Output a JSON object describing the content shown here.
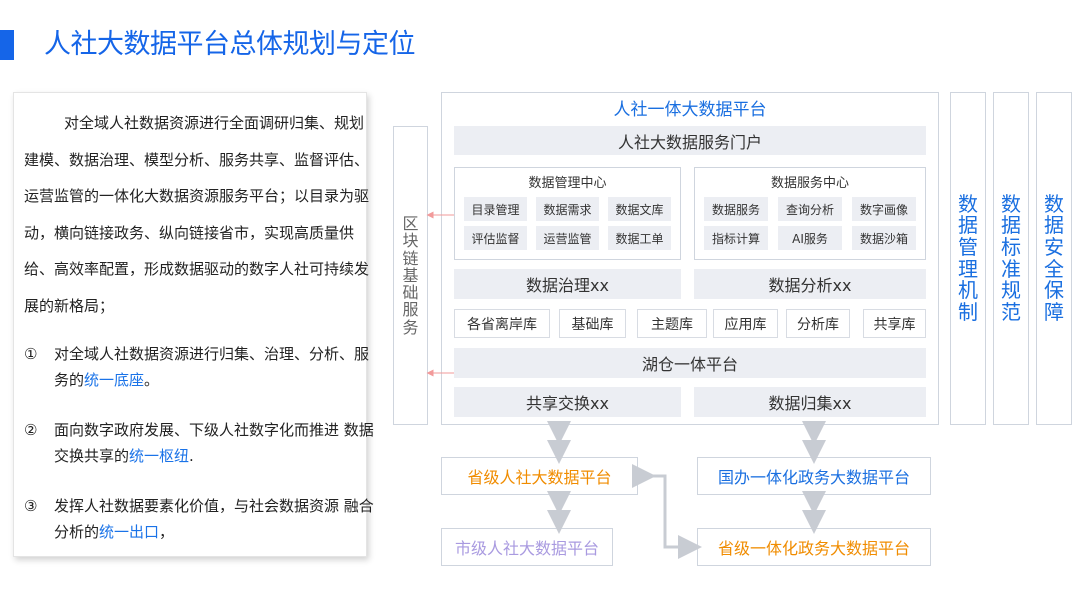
{
  "page": {
    "title": "人社大数据平台总体规划与定位"
  },
  "text_panel": {
    "intro": "对全域人社数据资源进行全面调研归集、规划建模、数据治理、模型分析、服务共享、监督评估、运营监管的一体化大数据资源服务平台；以目录为驱动，横向链接政务、纵向链接省市，实现高质量供给、高效率配置，形成数据驱动的数字人社可持续发展的新格局；",
    "points": [
      {
        "num": "①",
        "text": "对全域人社数据资源进行归集、治理、分析、服务的",
        "highlight": "统一底座",
        "tail": "。"
      },
      {
        "num": "②",
        "text": "面向数字政府发展、下级人社数字化而推进 数据交换共享的",
        "highlight": "统一枢纽",
        "tail": "."
      },
      {
        "num": "③",
        "text": "发挥人社数据要素化价值，与社会数据资源 融合分析的",
        "highlight": "统一出口",
        "tail": "，"
      }
    ]
  },
  "diagram": {
    "blockchain": "区块链基础服务",
    "platform_title": "人社一体大数据平台",
    "portal": "人社大数据服务门户",
    "mgmt_center": {
      "title": "数据管理中心",
      "items": [
        "目录管理",
        "数据需求",
        "数据文库",
        "评估监督",
        "运营监管",
        "数据工单"
      ]
    },
    "service_center": {
      "title": "数据服务中心",
      "items": [
        "数据服务",
        "查询分析",
        "数字画像",
        "指标计算",
        "AI服务",
        "数据沙箱"
      ]
    },
    "governance": "数据治理xx",
    "analysis": "数据分析xx",
    "libraries": [
      "各省离岸库",
      "基础库",
      "主题库",
      "应用库",
      "分析库",
      "共享库"
    ],
    "lakehouse": "湖仓一体平台",
    "exchange": "共享交换xx",
    "collection": "数据归集xx",
    "side_columns": [
      "数据管理机制",
      "数据标准规范",
      "数据安全保障"
    ],
    "provincial": "省级人社大数据平台",
    "national": "国办一体化政务大数据平台",
    "city": "市级人社大数据平台",
    "provincial_gov": "省级一体化政务大数据平台",
    "colors": {
      "blue": "#1a6fe0",
      "orange": "#f08c00",
      "lavender": "#a99ae0",
      "gray_box": "#eceef3"
    }
  }
}
